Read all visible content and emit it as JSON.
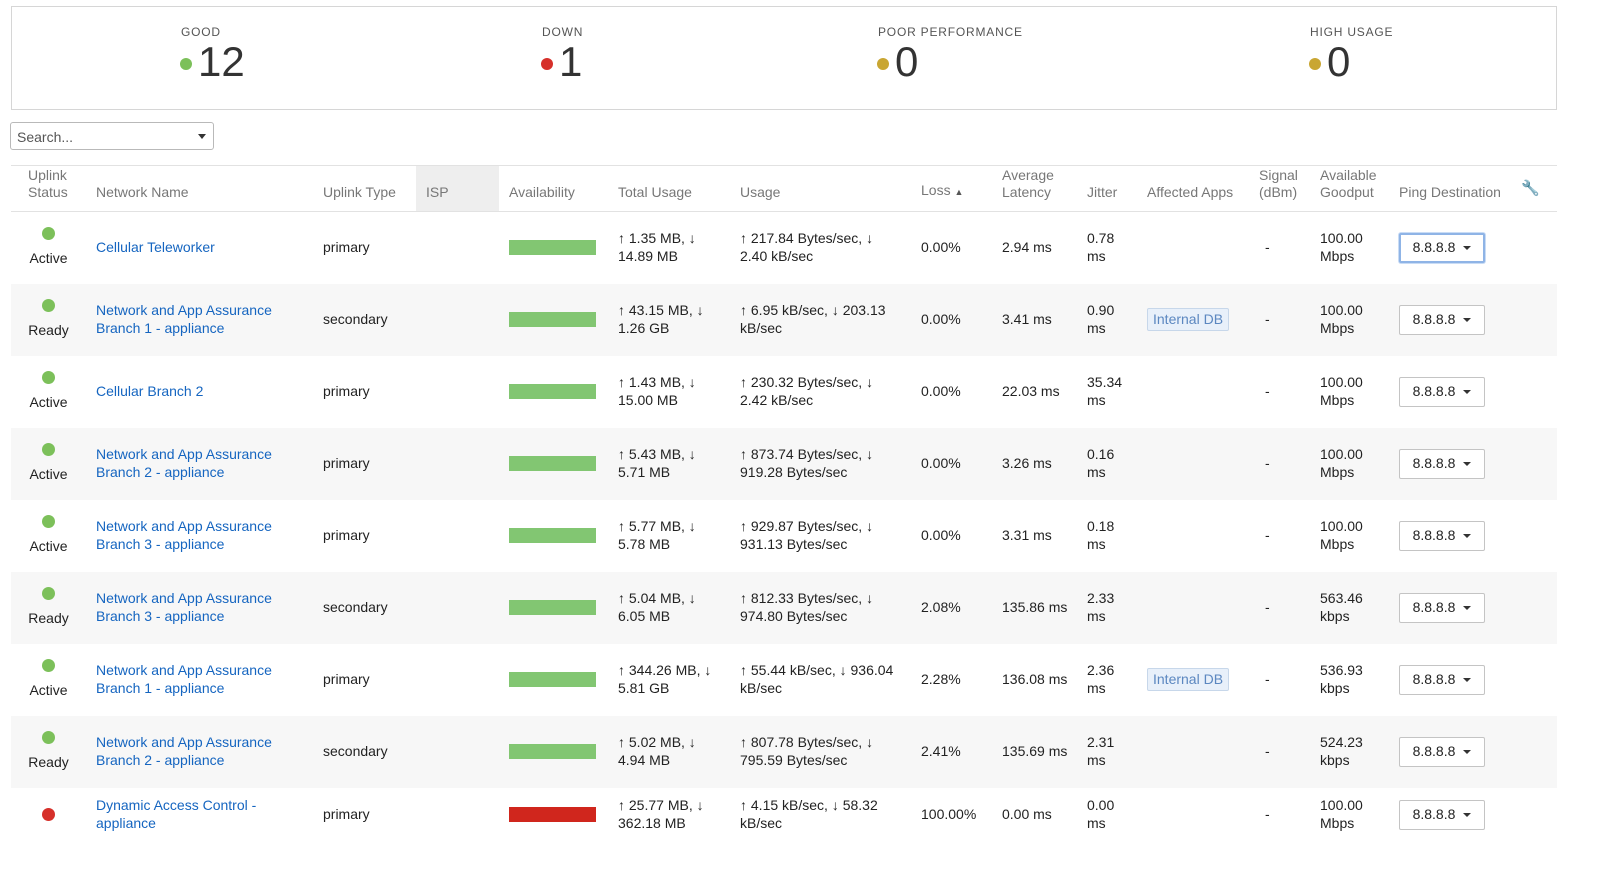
{
  "summary": [
    {
      "label": "GOOD",
      "value": "12",
      "color": "#7cc05a"
    },
    {
      "label": "DOWN",
      "value": "1",
      "color": "#d6302a"
    },
    {
      "label": "POOR PERFORMANCE",
      "value": "0",
      "color": "#c9a632"
    },
    {
      "label": "HIGH USAGE",
      "value": "0",
      "color": "#c9a632"
    }
  ],
  "search": {
    "placeholder": "Search..."
  },
  "columns": {
    "uplink_status": "Uplink Status",
    "network_name": "Network Name",
    "uplink_type": "Uplink Type",
    "isp": "ISP",
    "availability": "Availability",
    "total_usage": "Total Usage",
    "usage": "Usage",
    "loss": "Loss",
    "loss_sort": "▲",
    "avg_latency": "Average Latency",
    "jitter": "Jitter",
    "affected_apps": "Affected Apps",
    "signal": "Signal (dBm)",
    "goodput": "Available Goodput",
    "ping": "Ping Destination",
    "settings_icon": "wrench-icon"
  },
  "colors": {
    "good": "#7cc05a",
    "down": "#d6302a",
    "link": "#1565c0"
  },
  "rows": [
    {
      "status_color": "#7cc05a",
      "status": "Active",
      "name": "Cellular Teleworker",
      "type": "primary",
      "isp": "",
      "availability_color": "#82c672",
      "total_usage": "↑ 1.35 MB, ↓ 14.89 MB",
      "usage": "↑ 217.84 Bytes/sec, ↓ 2.40 kB/sec",
      "loss": "0.00%",
      "latency": "2.94 ms",
      "jitter": "0.78 ms",
      "apps": "",
      "signal": "-",
      "goodput": "100.00 Mbps",
      "ping": "8.8.8.8",
      "ping_focused": true
    },
    {
      "status_color": "#7cc05a",
      "status": "Ready",
      "name": "Network and App Assurance Branch 1 - appliance",
      "type": "secondary",
      "isp": "",
      "availability_color": "#82c672",
      "total_usage": "↑ 43.15 MB, ↓ 1.26 GB",
      "usage": "↑ 6.95 kB/sec, ↓ 203.13 kB/sec",
      "loss": "0.00%",
      "latency": "3.41 ms",
      "jitter": "0.90 ms",
      "apps": "Internal DB",
      "signal": "-",
      "goodput": "100.00 Mbps",
      "ping": "8.8.8.8",
      "ping_focused": false
    },
    {
      "status_color": "#7cc05a",
      "status": "Active",
      "name": "Cellular Branch 2",
      "type": "primary",
      "isp": "",
      "availability_color": "#82c672",
      "total_usage": "↑ 1.43 MB, ↓ 15.00 MB",
      "usage": "↑ 230.32 Bytes/sec, ↓ 2.42 kB/sec",
      "loss": "0.00%",
      "latency": "22.03 ms",
      "jitter": "35.34 ms",
      "apps": "",
      "signal": "-",
      "goodput": "100.00 Mbps",
      "ping": "8.8.8.8",
      "ping_focused": false
    },
    {
      "status_color": "#7cc05a",
      "status": "Active",
      "name": "Network and App Assurance Branch 2 - appliance",
      "type": "primary",
      "isp": "",
      "availability_color": "#82c672",
      "total_usage": "↑ 5.43 MB, ↓ 5.71 MB",
      "usage": "↑ 873.74 Bytes/sec, ↓ 919.28 Bytes/sec",
      "loss": "0.00%",
      "latency": "3.26 ms",
      "jitter": "0.16 ms",
      "apps": "",
      "signal": "-",
      "goodput": "100.00 Mbps",
      "ping": "8.8.8.8",
      "ping_focused": false
    },
    {
      "status_color": "#7cc05a",
      "status": "Active",
      "name": "Network and App Assurance Branch 3 - appliance",
      "type": "primary",
      "isp": "",
      "availability_color": "#82c672",
      "total_usage": "↑ 5.77 MB, ↓ 5.78 MB",
      "usage": "↑ 929.87 Bytes/sec, ↓ 931.13 Bytes/sec",
      "loss": "0.00%",
      "latency": "3.31 ms",
      "jitter": "0.18 ms",
      "apps": "",
      "signal": "-",
      "goodput": "100.00 Mbps",
      "ping": "8.8.8.8",
      "ping_focused": false
    },
    {
      "status_color": "#7cc05a",
      "status": "Ready",
      "name": "Network and App Assurance Branch 3 - appliance",
      "type": "secondary",
      "isp": "",
      "availability_color": "#82c672",
      "total_usage": "↑ 5.04 MB, ↓ 6.05 MB",
      "usage": "↑ 812.33 Bytes/sec, ↓ 974.80 Bytes/sec",
      "loss": "2.08%",
      "latency": "135.86 ms",
      "jitter": "2.33 ms",
      "apps": "",
      "signal": "-",
      "goodput": "563.46 kbps",
      "ping": "8.8.8.8",
      "ping_focused": false
    },
    {
      "status_color": "#7cc05a",
      "status": "Active",
      "name": "Network and App Assurance Branch 1 - appliance",
      "type": "primary",
      "isp": "",
      "availability_color": "#82c672",
      "total_usage": "↑ 344.26 MB, ↓ 5.81 GB",
      "usage": "↑ 55.44 kB/sec, ↓ 936.04 kB/sec",
      "loss": "2.28%",
      "latency": "136.08 ms",
      "jitter": "2.36 ms",
      "apps": "Internal DB",
      "signal": "-",
      "goodput": "536.93 kbps",
      "ping": "8.8.8.8",
      "ping_focused": false
    },
    {
      "status_color": "#7cc05a",
      "status": "Ready",
      "name": "Network and App Assurance Branch 2 - appliance",
      "type": "secondary",
      "isp": "",
      "availability_color": "#82c672",
      "total_usage": "↑ 5.02 MB, ↓ 4.94 MB",
      "usage": "↑ 807.78 Bytes/sec, ↓ 795.59 Bytes/sec",
      "loss": "2.41%",
      "latency": "135.69 ms",
      "jitter": "2.31 ms",
      "apps": "",
      "signal": "-",
      "goodput": "524.23 kbps",
      "ping": "8.8.8.8",
      "ping_focused": false
    },
    {
      "status_color": "#d6302a",
      "status": "",
      "name": "Dynamic Access Control - appliance",
      "type": "primary",
      "isp": "",
      "availability_color": "#d0261d",
      "total_usage": "↑ 25.77 MB, ↓ 362.18 MB",
      "usage": "↑ 4.15 kB/sec, ↓ 58.32 kB/sec",
      "loss": "100.00%",
      "latency": "0.00 ms",
      "jitter": "0.00 ms",
      "apps": "",
      "signal": "-",
      "goodput": "100.00 Mbps",
      "ping": "8.8.8.8",
      "ping_focused": false
    }
  ]
}
